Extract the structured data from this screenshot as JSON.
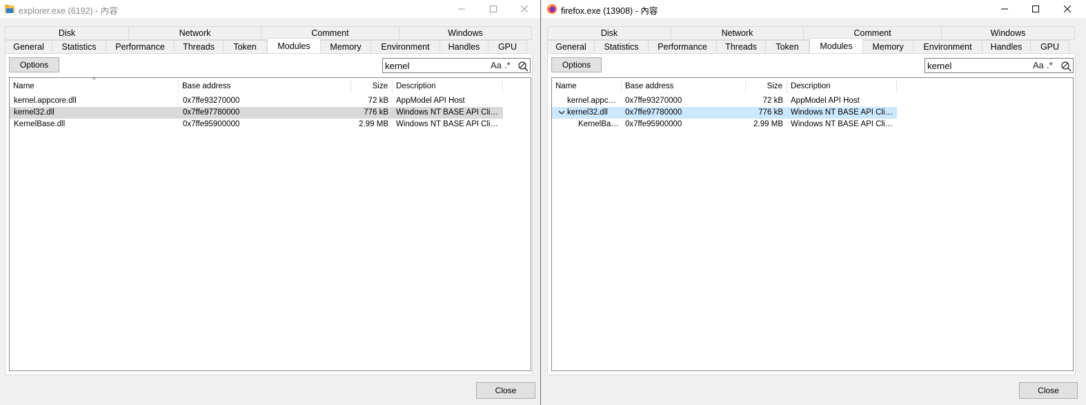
{
  "left": {
    "title": "explorer.exe (6192) - 內容",
    "icon": "explorer-folder-icon",
    "tabs_top": [
      "Disk",
      "Network",
      "Comment",
      "Windows"
    ],
    "tabs_bottom": [
      "General",
      "Statistics",
      "Performance",
      "Threads",
      "Token",
      "Modules",
      "Memory",
      "Environment",
      "Handles",
      "GPU"
    ],
    "active_tab": "Modules",
    "options_label": "Options",
    "search_value": "kernel",
    "search_opts": {
      "case": "Aa",
      "regex": ".*"
    },
    "columns": {
      "name": "Name",
      "base": "Base address",
      "size": "Size",
      "desc": "Description"
    },
    "rows": [
      {
        "name": "kernel.appcore.dll",
        "base": "0x7ffe93270000",
        "size": "72 kB",
        "desc": "AppModel API Host"
      },
      {
        "name": "kernel32.dll",
        "base": "0x7ffe97780000",
        "size": "776 kB",
        "desc": "Windows NT BASE API Clien…"
      },
      {
        "name": "KernelBase.dll",
        "base": "0x7ffe95900000",
        "size": "2.99 MB",
        "desc": "Windows NT BASE API Clien…"
      }
    ],
    "close_label": "Close"
  },
  "right": {
    "title": "firefox.exe (13908) - 內容",
    "icon": "firefox-icon",
    "tabs_top": [
      "Disk",
      "Network",
      "Comment",
      "Windows"
    ],
    "tabs_bottom": [
      "General",
      "Statistics",
      "Performance",
      "Threads",
      "Token",
      "Modules",
      "Memory",
      "Environment",
      "Handles",
      "GPU"
    ],
    "active_tab": "Modules",
    "options_label": "Options",
    "search_value": "kernel",
    "search_opts": {
      "case": "Aa",
      "regex": ".*"
    },
    "columns": {
      "name": "Name",
      "base": "Base address",
      "size": "Size",
      "desc": "Description"
    },
    "rows": [
      {
        "name": "kernel.appc…",
        "base": "0x7ffe93270000",
        "size": "72 kB",
        "desc": "AppModel API Host"
      },
      {
        "name": "kernel32.dll",
        "base": "0x7ffe97780000",
        "size": "776 kB",
        "desc": "Windows NT BASE API Clien…"
      },
      {
        "name": "KernelBa…",
        "base": "0x7ffe95900000",
        "size": "2.99 MB",
        "desc": "Windows NT BASE API Clien…"
      }
    ],
    "close_label": "Close"
  },
  "colors": {
    "selected_gray": "#d9d9d9",
    "selected_blue": "#cce8ff",
    "window_bg": "#f0f0f0"
  }
}
